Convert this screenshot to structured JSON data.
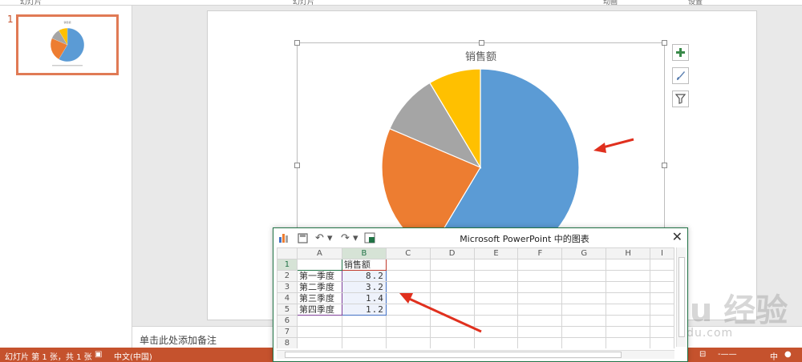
{
  "ribbon": {
    "labels": [
      "幻灯片",
      "幻灯片",
      "动画",
      "设置"
    ]
  },
  "thumbnails": {
    "slide_number": "1"
  },
  "chart": {
    "title": "销售额",
    "colors": [
      "#5b9bd5",
      "#ed7d31",
      "#a5a5a5",
      "#ffc000"
    ]
  },
  "chart_data": {
    "type": "pie",
    "title": "销售额",
    "categories": [
      "第一季度",
      "第二季度",
      "第三季度",
      "第四季度"
    ],
    "values": [
      8.2,
      3.2,
      1.4,
      1.2
    ],
    "colors": [
      "#5b9bd5",
      "#ed7d31",
      "#a5a5a5",
      "#ffc000"
    ]
  },
  "side_buttons": [
    "plus-icon",
    "brush-icon",
    "filter-icon"
  ],
  "notes": {
    "placeholder": "单击此处添加备注"
  },
  "status": {
    "slide_info": "幻灯片 第 1 张，共 1 张",
    "language": "中文(中国)",
    "ime": "中"
  },
  "data_window": {
    "title": "Microsoft PowerPoint 中的图表",
    "close": "✕",
    "columns": [
      "A",
      "B",
      "C",
      "D",
      "E",
      "F",
      "G",
      "H",
      "I"
    ],
    "row_numbers": [
      "1",
      "2",
      "3",
      "4",
      "5",
      "6",
      "7",
      "8"
    ],
    "header_b": "销售额",
    "rows": [
      {
        "label": "第一季度",
        "value": "8.2"
      },
      {
        "label": "第二季度",
        "value": "3.2"
      },
      {
        "label": "第三季度",
        "value": "1.4"
      },
      {
        "label": "第四季度",
        "value": "1.2"
      }
    ]
  },
  "watermark": {
    "main": "Baidu 经验",
    "sub": "jingyan.baidu.com"
  }
}
